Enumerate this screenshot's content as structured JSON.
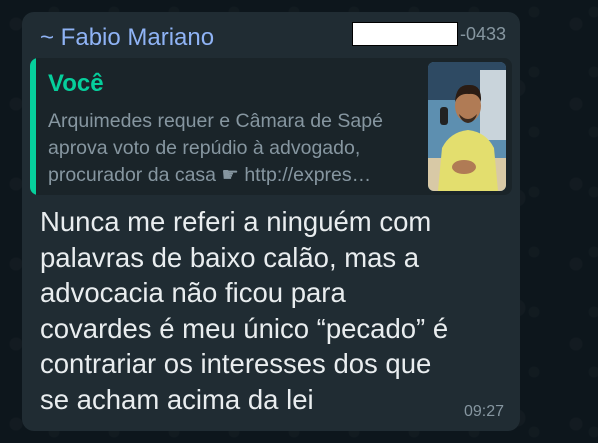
{
  "message": {
    "sender": "~ Fabio Mariano",
    "phone_suffix": "-0433",
    "quote": {
      "author": "Você",
      "lines": [
        "Arquimedes requer e Câmara de Sapé",
        "aprova voto de repúdio à advogado,",
        "procurador da casa ☛ http://expres…"
      ],
      "thumbnail": "man-in-yellow-shirt-at-microphone"
    },
    "lines": [
      "Nunca me referi a ninguém com",
      "palavras de baixo calão, mas a",
      "advocacia não ficou para",
      "covardes é meu único “pecado” é",
      "contrariar os interesses dos que",
      "se acham acima da lei"
    ],
    "time": "09:27"
  },
  "colors": {
    "sender_name": "#8fb3f5",
    "quote_accent": "#06cf9c",
    "bubble": "#202c33"
  }
}
